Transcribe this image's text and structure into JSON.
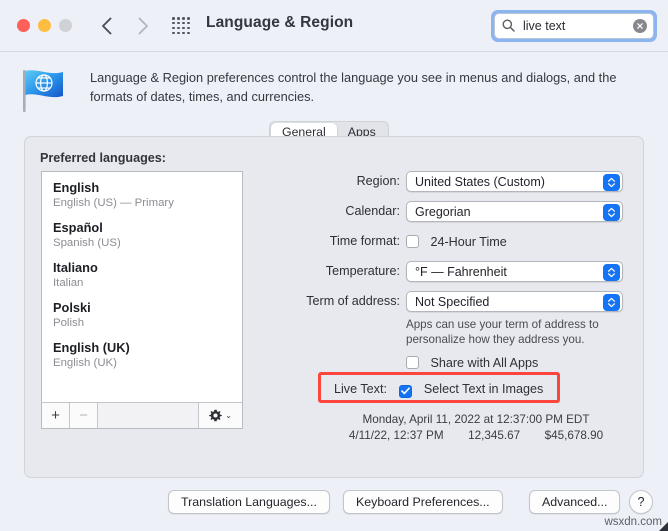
{
  "window": {
    "title": "Language & Region",
    "traffic_lights": [
      "close",
      "minimize",
      "zoom"
    ],
    "nav_back": "back-arrow",
    "nav_forward": "forward-arrow",
    "grid_icon": "grid-view-icon"
  },
  "search": {
    "value": "live text",
    "placeholder": "Search",
    "icon": "search-icon",
    "clear_icon": "clear-icon"
  },
  "header": {
    "icon": "globe-flag-icon",
    "description": "Language & Region preferences control the language you see in menus and dialogs, and the formats of dates, times, and currencies."
  },
  "tabs": [
    {
      "label": "General",
      "selected": true
    },
    {
      "label": "Apps",
      "selected": false
    }
  ],
  "languages": {
    "label": "Preferred languages:",
    "items": [
      {
        "name": "English",
        "sub": "English (US) — Primary"
      },
      {
        "name": "Español",
        "sub": "Spanish (US)"
      },
      {
        "name": "Italiano",
        "sub": "Italian"
      },
      {
        "name": "Polski",
        "sub": "Polish"
      },
      {
        "name": "English (UK)",
        "sub": "English (UK)"
      }
    ],
    "add_label": "+",
    "remove_label": "−",
    "gear_icon": "gear-icon",
    "gear_caret": "⌄"
  },
  "form": {
    "region": {
      "label": "Region:",
      "value": "United States (Custom)"
    },
    "calendar": {
      "label": "Calendar:",
      "value": "Gregorian"
    },
    "time_format": {
      "label": "Time format:",
      "checkbox_label": "24-Hour Time",
      "checked": false
    },
    "temperature": {
      "label": "Temperature:",
      "value": "°F — Fahrenheit"
    },
    "term_of_address": {
      "label": "Term of address:",
      "value": "Not Specified"
    },
    "term_help": "Apps can use your term of address to personalize how they address you.",
    "share_all_apps": {
      "checkbox_label": "Share with All Apps",
      "checked": false
    },
    "live_text": {
      "label": "Live Text:",
      "checkbox_label": "Select Text in Images",
      "checked": true,
      "highlight_color": "#fc453c"
    }
  },
  "preview": {
    "line1": "Monday, April 11, 2022 at 12:37:00 PM EDT",
    "line2_date": "4/11/22, 12:37 PM",
    "line2_number": "12,345.67",
    "line2_currency": "$45,678.90"
  },
  "footer": {
    "translation": "Translation Languages...",
    "keyboard": "Keyboard Preferences...",
    "advanced": "Advanced...",
    "help": "?"
  },
  "watermark": "wsxdn.com",
  "colors": {
    "accent": "#1574f5",
    "highlight": "#fc453c",
    "window_bg": "#eef0f7",
    "panel_bg": "#e7e9ef"
  }
}
